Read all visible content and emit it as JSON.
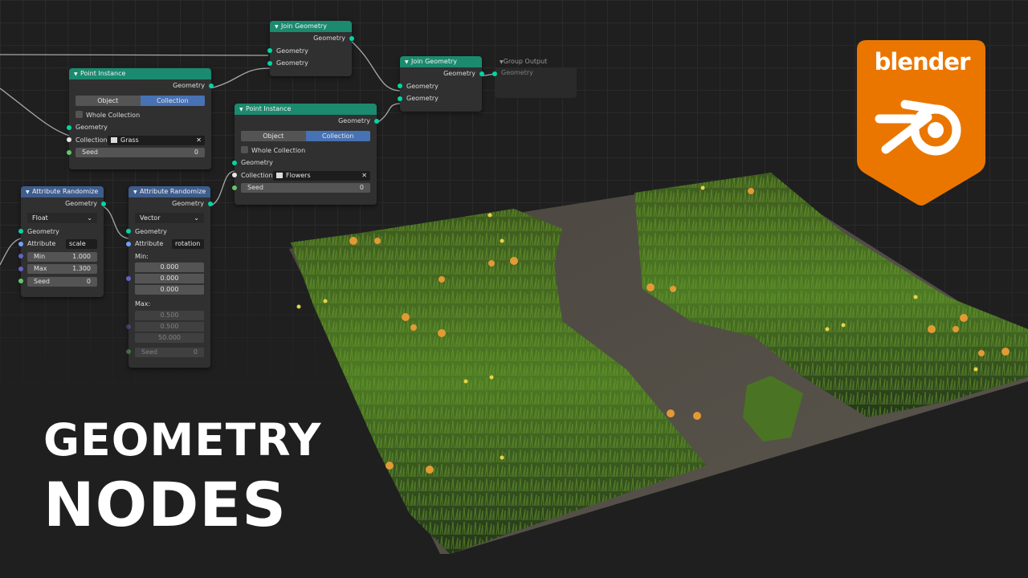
{
  "nodes": {
    "join1": {
      "title": "Join Geometry",
      "out": "Geometry",
      "in1": "Geometry",
      "in2": "Geometry"
    },
    "join2": {
      "title": "Join Geometry",
      "out": "Geometry",
      "in1": "Geometry",
      "in2": "Geometry"
    },
    "group_output": {
      "title": "Group Output",
      "in": "Geometry"
    },
    "pi1": {
      "title": "Point Instance",
      "out": "Geometry",
      "seg_object": "Object",
      "seg_collection": "Collection",
      "whole": "Whole Collection",
      "in_geo": "Geometry",
      "coll_label": "Collection:",
      "coll_value": "Grass",
      "seed_label": "Seed",
      "seed_value": "0"
    },
    "pi2": {
      "title": "Point Instance",
      "out": "Geometry",
      "seg_object": "Object",
      "seg_collection": "Collection",
      "whole": "Whole Collection",
      "in_geo": "Geometry",
      "coll_label": "Collection:",
      "coll_value": "Flowers",
      "seed_label": "Seed",
      "seed_value": "0"
    },
    "ar1": {
      "title": "Attribute Randomize",
      "out": "Geometry",
      "type": "Float",
      "in_geo": "Geometry",
      "attr_label": "Attribute",
      "attr_value": "scale",
      "min_label": "Min",
      "min_value": "1.000",
      "max_label": "Max",
      "max_value": "1.300",
      "seed_label": "Seed",
      "seed_value": "0"
    },
    "ar2": {
      "title": "Attribute Randomize",
      "out": "Geometry",
      "type": "Vector",
      "in_geo": "Geometry",
      "attr_label": "Attribute",
      "attr_value": "rotation",
      "min_label": "Min:",
      "min_values": [
        "0.000",
        "0.000",
        "0.000"
      ],
      "max_label": "Max:",
      "max_values": [
        "0.500",
        "0.500",
        "50.000"
      ],
      "seed_label": "Seed",
      "seed_value": "0"
    }
  },
  "headline": {
    "line1": "GEOMETRY",
    "line2": "NODES"
  },
  "logo": {
    "word": "blender",
    "color": "#ea7600"
  },
  "colors": {
    "node_header_green": "#1b8a6f",
    "node_header_blue": "#3e5c8c",
    "socket_geometry": "#00d6a3",
    "selected": "#4772b3"
  }
}
